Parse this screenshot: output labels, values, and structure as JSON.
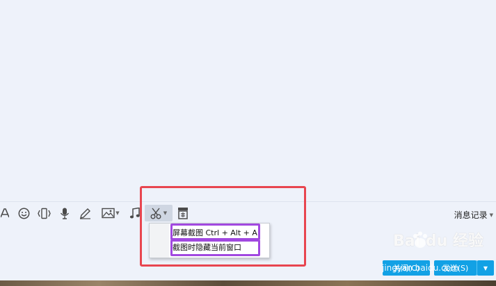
{
  "toolbar": {
    "items": [
      {
        "icon": "font-icon"
      },
      {
        "icon": "emoji-icon"
      },
      {
        "icon": "shake-icon"
      },
      {
        "icon": "microphone-icon"
      },
      {
        "icon": "pen-icon"
      },
      {
        "icon": "image-icon"
      },
      {
        "icon": "music-icon"
      },
      {
        "icon": "scissors-icon"
      },
      {
        "icon": "archive-icon"
      }
    ],
    "message_record_label": "消息记录"
  },
  "screenshot_menu": {
    "items": [
      {
        "label": "屏幕截图 Ctrl + Alt + A"
      },
      {
        "label": "截图时隐藏当前窗口"
      }
    ]
  },
  "buttons": {
    "close_label": "关闭(C)",
    "send_label": "发送(S)"
  },
  "watermark": {
    "brand": "Bai du 经验",
    "url": "jingyan.baidu.com"
  },
  "colors": {
    "accent": "#12a1e5",
    "highlight_purple": "#a148e0",
    "annotation_red": "#e8454f",
    "background": "#eef2fa"
  }
}
